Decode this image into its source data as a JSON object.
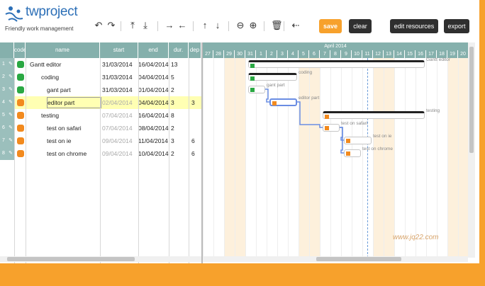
{
  "app": {
    "brand": "twproject",
    "tagline": "Friendly work management"
  },
  "toolbar": {
    "icons": [
      {
        "name": "undo-icon",
        "glyph": "↶"
      },
      {
        "name": "redo-icon",
        "glyph": "↷"
      },
      {
        "name": "insert-above-icon",
        "glyph": "⤒"
      },
      {
        "name": "insert-below-icon",
        "glyph": "⤓"
      },
      {
        "name": "indent-icon",
        "glyph": "→"
      },
      {
        "name": "outdent-icon",
        "glyph": "←"
      },
      {
        "name": "move-up-icon",
        "glyph": "↑"
      },
      {
        "name": "move-down-icon",
        "glyph": "↓"
      },
      {
        "name": "zoom-out-icon",
        "glyph": "⊖"
      },
      {
        "name": "zoom-in-icon",
        "glyph": "⊕"
      },
      {
        "name": "delete-icon",
        "glyph": "🗑"
      },
      {
        "name": "dependency-icon",
        "glyph": "⇠"
      }
    ],
    "save_label": "save",
    "clear_label": "clear",
    "edit_resources_label": "edit resources",
    "export_label": "export"
  },
  "grid": {
    "columns": [
      "code",
      "name",
      "start",
      "end",
      "dur.",
      "dep"
    ],
    "rows": [
      {
        "num": "1",
        "status": "#2aa843",
        "name": "Gantt editor",
        "start": "31/03/2014",
        "end": "16/04/2014",
        "dur": "13",
        "dep": "",
        "start_muted": false,
        "selected": false
      },
      {
        "num": "2",
        "status": "#2aa843",
        "name": "coding",
        "start": "31/03/2014",
        "end": "04/04/2014",
        "dur": "5",
        "dep": "",
        "start_muted": false,
        "selected": false
      },
      {
        "num": "3",
        "status": "#2aa843",
        "name": "gant part",
        "start": "31/03/2014",
        "end": "01/04/2014",
        "dur": "2",
        "dep": "",
        "start_muted": false,
        "selected": false
      },
      {
        "num": "4",
        "status": "#f28a1e",
        "name": "editor part",
        "start": "02/04/2014",
        "end": "04/04/2014",
        "dur": "3",
        "dep": "3",
        "start_muted": true,
        "selected": true
      },
      {
        "num": "5",
        "status": "#f28a1e",
        "name": "testing",
        "start": "07/04/2014",
        "end": "16/04/2014",
        "dur": "8",
        "dep": "",
        "start_muted": true,
        "selected": false
      },
      {
        "num": "6",
        "status": "#f28a1e",
        "name": "test on safari",
        "start": "07/04/2014",
        "end": "08/04/2014",
        "dur": "2",
        "dep": "",
        "start_muted": true,
        "selected": false
      },
      {
        "num": "7",
        "status": "#f28a1e",
        "name": "test on ie",
        "start": "09/04/2014",
        "end": "11/04/2014",
        "dur": "3",
        "dep": "6",
        "start_muted": true,
        "selected": false
      },
      {
        "num": "8",
        "status": "#f28a1e",
        "name": "test on chrome",
        "start": "09/04/2014",
        "end": "10/04/2014",
        "dur": "2",
        "dep": "6",
        "start_muted": true,
        "selected": false
      }
    ]
  },
  "gantt": {
    "month_label": "April 2014",
    "days": [
      "27",
      "28",
      "29",
      "30",
      "31",
      "1",
      "2",
      "3",
      "4",
      "5",
      "6",
      "7",
      "8",
      "9",
      "10",
      "11",
      "12",
      "13",
      "14",
      "15",
      "16",
      "17",
      "18",
      "19",
      "20"
    ],
    "weekend_days": [
      "29",
      "30",
      "5",
      "6",
      "12",
      "13",
      "19",
      "20"
    ],
    "bar_labels": [
      "Gantt editor",
      "coding",
      "gant part",
      "editor part",
      "testing",
      "test on safari",
      "test on ie",
      "test on chrome"
    ],
    "watermark": "www.jq22.com"
  },
  "colors": {
    "header_teal": "#85b0ac",
    "accent_orange": "#f7a12c",
    "green_status": "#2aa843",
    "orange_status": "#f28a1e",
    "selected_row": "#ffffb3"
  }
}
